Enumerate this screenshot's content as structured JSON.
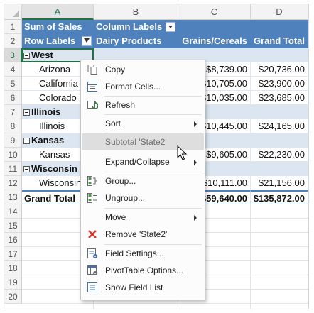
{
  "columns": [
    "A",
    "B",
    "C",
    "D"
  ],
  "rows": [
    "1",
    "2",
    "3",
    "4",
    "5",
    "6",
    "7",
    "8",
    "9",
    "10",
    "11",
    "12",
    "13",
    "14",
    "15",
    "16",
    "17",
    "18",
    "19",
    "20"
  ],
  "pivot": {
    "r1": {
      "a": "Sum of Sales",
      "b": "Column Labels"
    },
    "r2": {
      "a": "Row Labels",
      "b": "Dairy Products",
      "c": "Grains/Cereals",
      "d": "Grand Total"
    },
    "west": "West",
    "arizona": {
      "name": "Arizona",
      "c": "$8,739.00",
      "d": "$20,736.00"
    },
    "california": {
      "name": "California",
      "c": "$10,705.00",
      "d": "$23,900.00"
    },
    "colorado": {
      "name": "Colorado",
      "c": "$10,035.00",
      "d": "$23,685.00"
    },
    "illinois_grp": "Illinois",
    "illinois": {
      "name": "Illinois",
      "c": "$10,445.00",
      "d": "$24,165.00"
    },
    "kansas_grp": "Kansas",
    "kansas": {
      "name": "Kansas",
      "c": "$9,605.00",
      "d": "$22,230.00"
    },
    "wisconsin_grp": "Wisconsin",
    "wisconsin": {
      "name": "Wisconsin",
      "c": "$10,111.00",
      "d": "$21,156.00"
    },
    "grand": {
      "name": "Grand Total",
      "c": "$59,640.00",
      "d": "$135,872.00"
    }
  },
  "menu": {
    "copy": "Copy",
    "format": "Format Cells...",
    "refresh": "Refresh",
    "sort": "Sort",
    "subtotal": "Subtotal 'State2'",
    "expand": "Expand/Collapse",
    "group": "Group...",
    "ungroup": "Ungroup...",
    "move": "Move",
    "remove": "Remove 'State2'",
    "fieldsettings": "Field Settings...",
    "options": "PivotTable Options...",
    "fieldlist": "Show Field List"
  },
  "colors": {
    "header": "#4f81bd",
    "group": "#dce6f1",
    "accent": "#217346",
    "remove": "#d9372b"
  }
}
